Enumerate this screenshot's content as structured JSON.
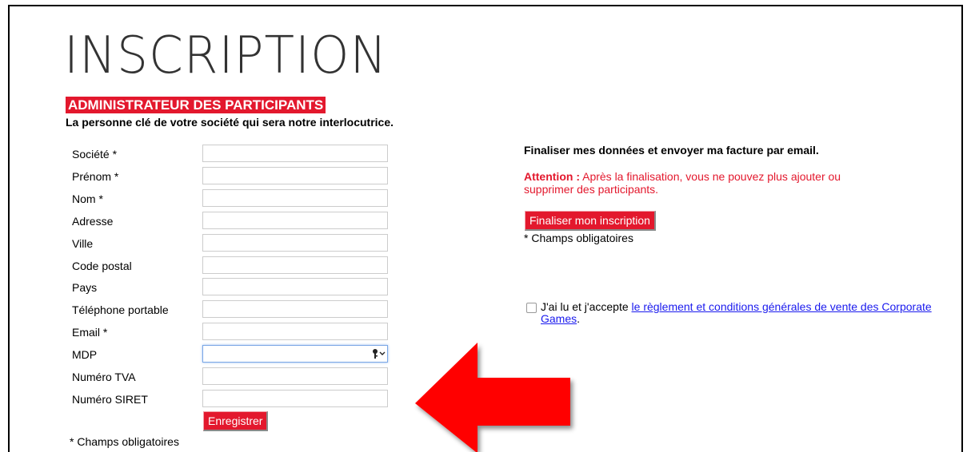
{
  "page": {
    "title": "INSCRIPTION"
  },
  "section": {
    "heading": "ADMINISTRATEUR DES PARTICIPANTS",
    "subtitle": "La personne clé de votre société qui sera notre interlocutrice."
  },
  "form": {
    "fields": [
      {
        "label": "Société *",
        "value": ""
      },
      {
        "label": "Prénom *",
        "value": ""
      },
      {
        "label": "Nom *",
        "value": ""
      },
      {
        "label": "Adresse",
        "value": ""
      },
      {
        "label": "Ville",
        "value": ""
      },
      {
        "label": "Code postal",
        "value": ""
      },
      {
        "label": "Pays",
        "value": ""
      },
      {
        "label": "Téléphone portable",
        "value": ""
      },
      {
        "label": "Email *",
        "value": ""
      },
      {
        "label": "MDP",
        "value": ""
      },
      {
        "label": "Numéro TVA",
        "value": ""
      },
      {
        "label": "Numéro SIRET",
        "value": ""
      }
    ],
    "save_label": "Enregistrer",
    "required_note": "* Champs obligatoires"
  },
  "finalize": {
    "heading": "Finaliser mes données et envoyer ma facture par email.",
    "warning_label": "Attention :",
    "warning_text": "Après la finalisation, vous ne pouvez plus ajouter ou supprimer des participants.",
    "button_label": "Finaliser mon inscription",
    "required_note": "* Champs obligatoires"
  },
  "terms": {
    "checked": false,
    "prefix": "J'ai lu et j'accepte",
    "link_text": "le règlement et conditions générales de vente des Corporate Games",
    "suffix": "."
  },
  "icons": {
    "password_manager": "key-dropdown-icon",
    "annotation": "red-arrow-left"
  },
  "colors": {
    "accent": "#e3182d",
    "link": "#1a1aee"
  }
}
